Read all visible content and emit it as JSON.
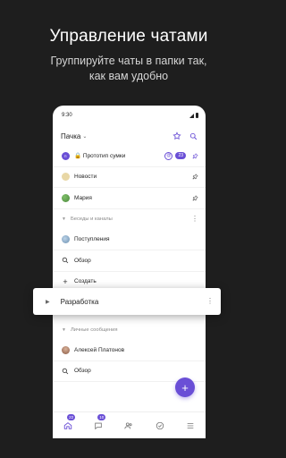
{
  "promo": {
    "title": "Управление чатами",
    "subtitle_line1": "Группируйте чаты в папки так,",
    "subtitle_line2": "как вам удобно"
  },
  "status_bar": {
    "time": "9:30"
  },
  "header": {
    "title": "Пачка"
  },
  "chats": [
    {
      "label": "🔒 Прототип сумки",
      "badge": "23",
      "mention": "@"
    },
    {
      "label": "Новости"
    },
    {
      "label": "Мария"
    }
  ],
  "section1": {
    "label": "Беседы и каналы"
  },
  "section1_items": [
    {
      "label": "Поступления"
    },
    {
      "label": "Обзор"
    },
    {
      "label": "Создать"
    }
  ],
  "dragging": {
    "label": "Разработка"
  },
  "section2": {
    "label": "Личные сообщения"
  },
  "section2_items": [
    {
      "label": "Алексей Платонов"
    },
    {
      "label": "Обзор"
    }
  ],
  "fab": {
    "label": "+"
  },
  "nav": {
    "badge1": "22",
    "badge2": "10"
  },
  "colors": {
    "accent": "#6a4fd6",
    "background": "#1e1e1e"
  }
}
